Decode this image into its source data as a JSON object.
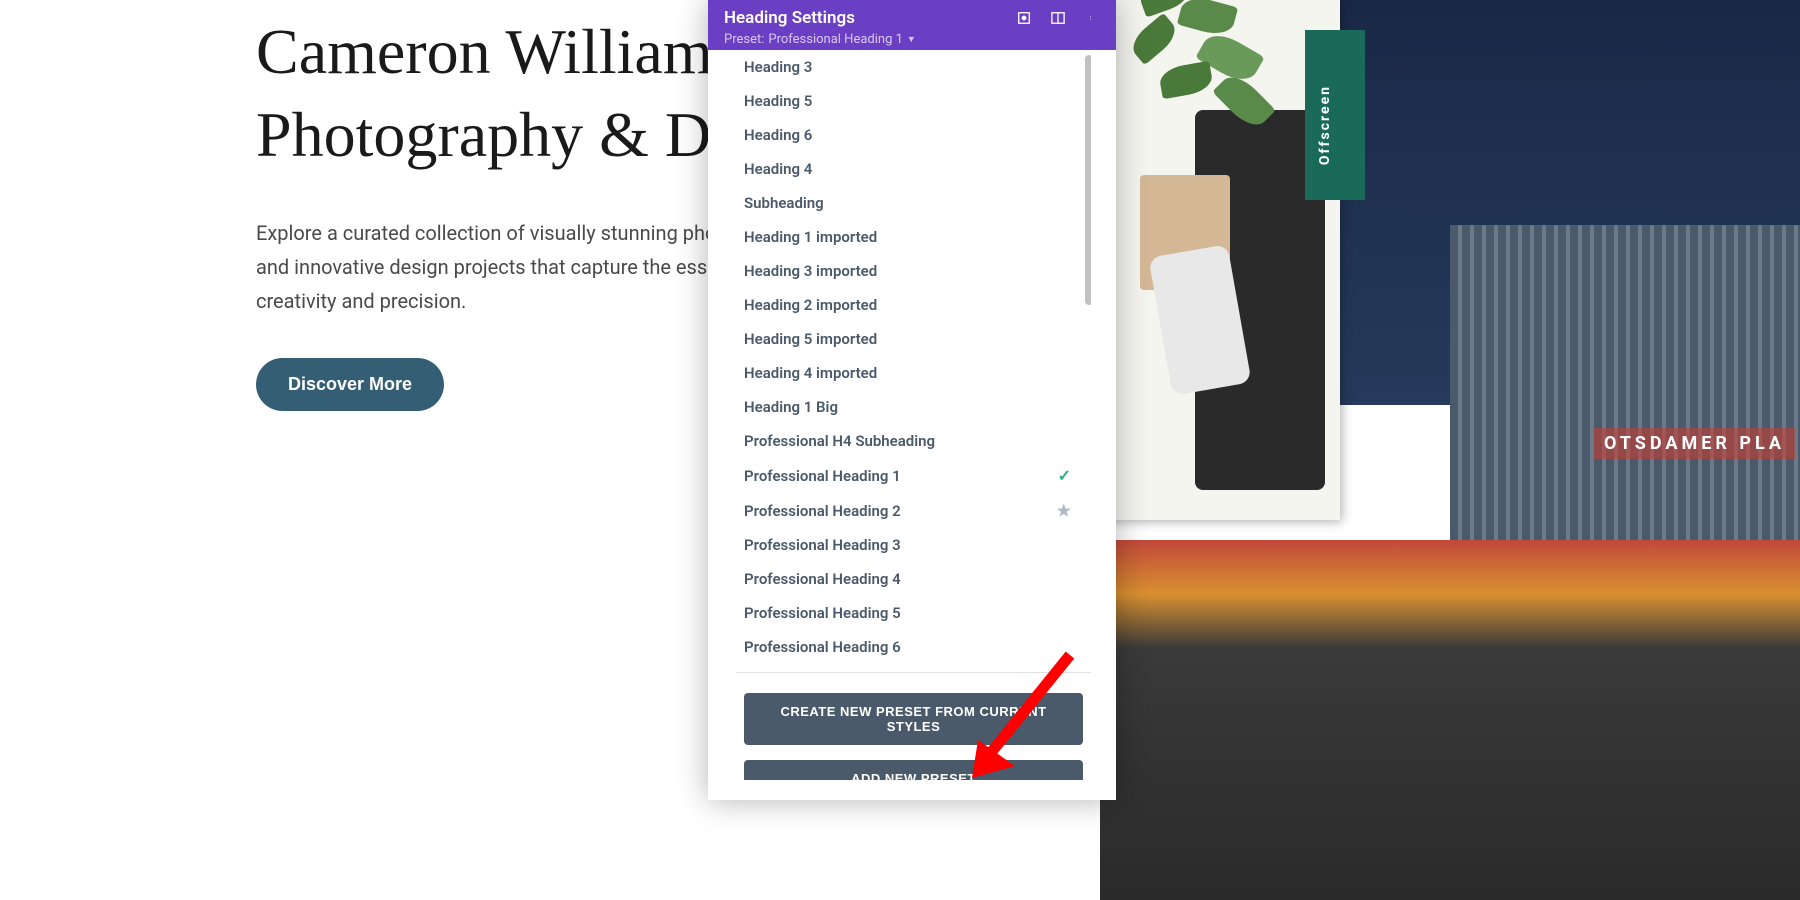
{
  "page": {
    "heading": "Cameron Williamson's Photography & Design",
    "subtitle": "Explore a curated collection of visually stunning photographs and innovative design projects that capture the essence of creativity and precision.",
    "cta_label": "Discover More"
  },
  "bg": {
    "sign_text": "OTSDAMER  PLA",
    "spine_text": "Offscreen"
  },
  "panel": {
    "title": "Heading Settings",
    "preset_label_prefix": "Preset:",
    "preset_current": "Professional Heading 1"
  },
  "presets": {
    "items": [
      {
        "label": "Heading 3"
      },
      {
        "label": "Heading 5"
      },
      {
        "label": "Heading 6"
      },
      {
        "label": "Heading 4"
      },
      {
        "label": "Subheading"
      },
      {
        "label": "Heading 1 imported"
      },
      {
        "label": "Heading 3 imported"
      },
      {
        "label": "Heading 2 imported"
      },
      {
        "label": "Heading 5 imported"
      },
      {
        "label": "Heading 4 imported"
      },
      {
        "label": "Heading 1 Big"
      },
      {
        "label": "Professional H4 Subheading"
      },
      {
        "label": "Professional Heading 1",
        "checked": true
      },
      {
        "label": "Professional Heading 2",
        "starred": true
      },
      {
        "label": "Professional Heading 3"
      },
      {
        "label": "Professional Heading 4"
      },
      {
        "label": "Professional Heading 5"
      },
      {
        "label": "Professional Heading 6"
      }
    ],
    "create_from_styles_label": "CREATE NEW PRESET FROM CURRENT STYLES",
    "add_new_label": "ADD NEW PRESET"
  }
}
